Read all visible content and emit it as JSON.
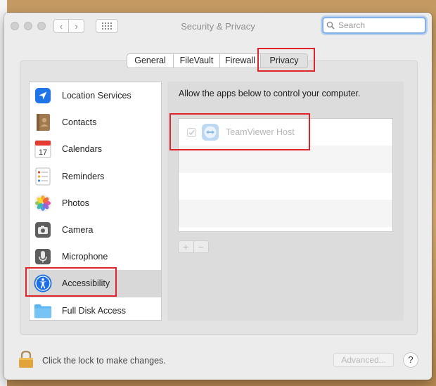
{
  "window": {
    "title": "Security & Privacy",
    "nav_back": "‹",
    "nav_forward": "›"
  },
  "search": {
    "placeholder": "Search",
    "value": ""
  },
  "tabs": [
    {
      "label": "General"
    },
    {
      "label": "FileVault"
    },
    {
      "label": "Firewall"
    },
    {
      "label": "Privacy",
      "selected": true
    }
  ],
  "categories": [
    {
      "label": "Location Services",
      "icon": "location-arrow-icon"
    },
    {
      "label": "Contacts",
      "icon": "contacts-book-icon"
    },
    {
      "label": "Calendars",
      "icon": "calendar-icon",
      "icon_text": "17"
    },
    {
      "label": "Reminders",
      "icon": "reminders-list-icon"
    },
    {
      "label": "Photos",
      "icon": "photos-flower-icon"
    },
    {
      "label": "Camera",
      "icon": "camera-icon"
    },
    {
      "label": "Microphone",
      "icon": "microphone-icon"
    },
    {
      "label": "Accessibility",
      "icon": "accessibility-icon",
      "selected": true
    },
    {
      "label": "Full Disk Access",
      "icon": "folder-icon"
    }
  ],
  "main": {
    "instruction": "Allow the apps below to control your computer.",
    "apps": [
      {
        "name": "TeamViewer Host",
        "checked": true,
        "enabled": false,
        "icon": "teamviewer-icon"
      }
    ],
    "add_label": "+",
    "remove_label": "−"
  },
  "footer": {
    "lock_text": "Click the lock to make changes.",
    "advanced_label": "Advanced...",
    "help_label": "?"
  },
  "colors": {
    "highlight": "#e0242c",
    "search_focus": "#86b2ea",
    "accent_blue": "#1b6ee5"
  }
}
